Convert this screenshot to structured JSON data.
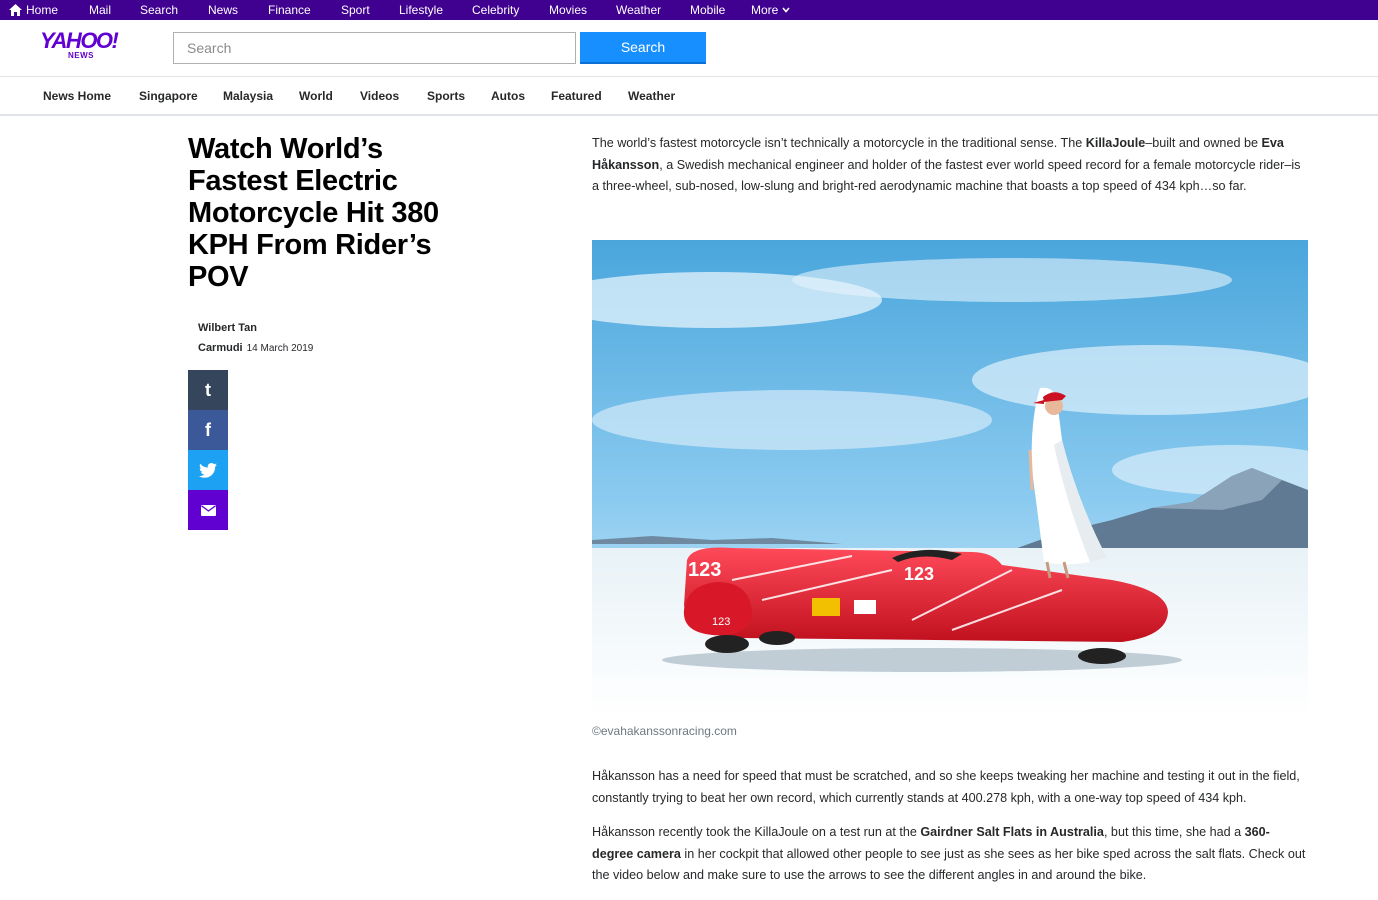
{
  "topnav": {
    "items": [
      "Home",
      "Mail",
      "Search",
      "News",
      "Finance",
      "Sport",
      "Lifestyle",
      "Celebrity",
      "Movies",
      "Weather",
      "Mobile",
      "More"
    ]
  },
  "header": {
    "logo_main": "YAHOO!",
    "logo_sub": "NEWS",
    "search_placeholder": "Search",
    "search_button": "Search"
  },
  "subnav": {
    "items": [
      "News Home",
      "Singapore",
      "Malaysia",
      "World",
      "Videos",
      "Sports",
      "Autos",
      "Featured",
      "Weather"
    ]
  },
  "article": {
    "headline": "Watch World’s Fastest Electric Motorcycle Hit 380 KPH From Rider’s POV",
    "author": "Wilbert Tan",
    "provider": "Carmudi",
    "date": "14 March 2019",
    "p1": {
      "t1": "The world’s fastest motorcycle isn’t technically a motorcycle in the traditional sense. The ",
      "b1": "KillaJoule",
      "t2": "–built and owned be ",
      "b2": "Eva Håkansson",
      "t3": ", a Swedish mechanical engineer and holder of the fastest ever world speed record for a female motorcycle rider–is a three-wheel, sub-nosed, low-slung and bright-red aerodynamic machine that boasts a top speed of 434 kph…so far."
    },
    "image_caption": "©evahakanssonracing.com",
    "vehicle_number": "123",
    "p2": "Håkansson has a need for speed that must be scratched, and so she keeps tweaking her machine and testing it out in the field, constantly trying to beat her own record, which currently stands at 400.278 kph, with a one-way top speed of 434 kph.",
    "p3": {
      "t1": "Håkansson recently took the KillaJoule on a test run at the ",
      "b1": "Gairdner Salt Flats in Australia",
      "t2": ", but this time, she had a ",
      "b2": "360-degree camera",
      "t3": " in her cockpit that allowed other people to see just as she sees as her bike sped across the salt flats. Check out the video below and make sure to use the arrows to see the different angles in and around the bike."
    }
  },
  "share": {
    "icons": [
      "tumblr-icon",
      "facebook-icon",
      "twitter-icon",
      "mail-icon"
    ],
    "tumblr_glyph": "t",
    "facebook_glyph": "f"
  },
  "colors": {
    "topbar": "#400090",
    "brand": "#6001d2",
    "search_button": "#188fff",
    "tumblr": "#35465c",
    "facebook": "#3b5998",
    "twitter": "#1da1f2",
    "mail": "#6001d2"
  }
}
